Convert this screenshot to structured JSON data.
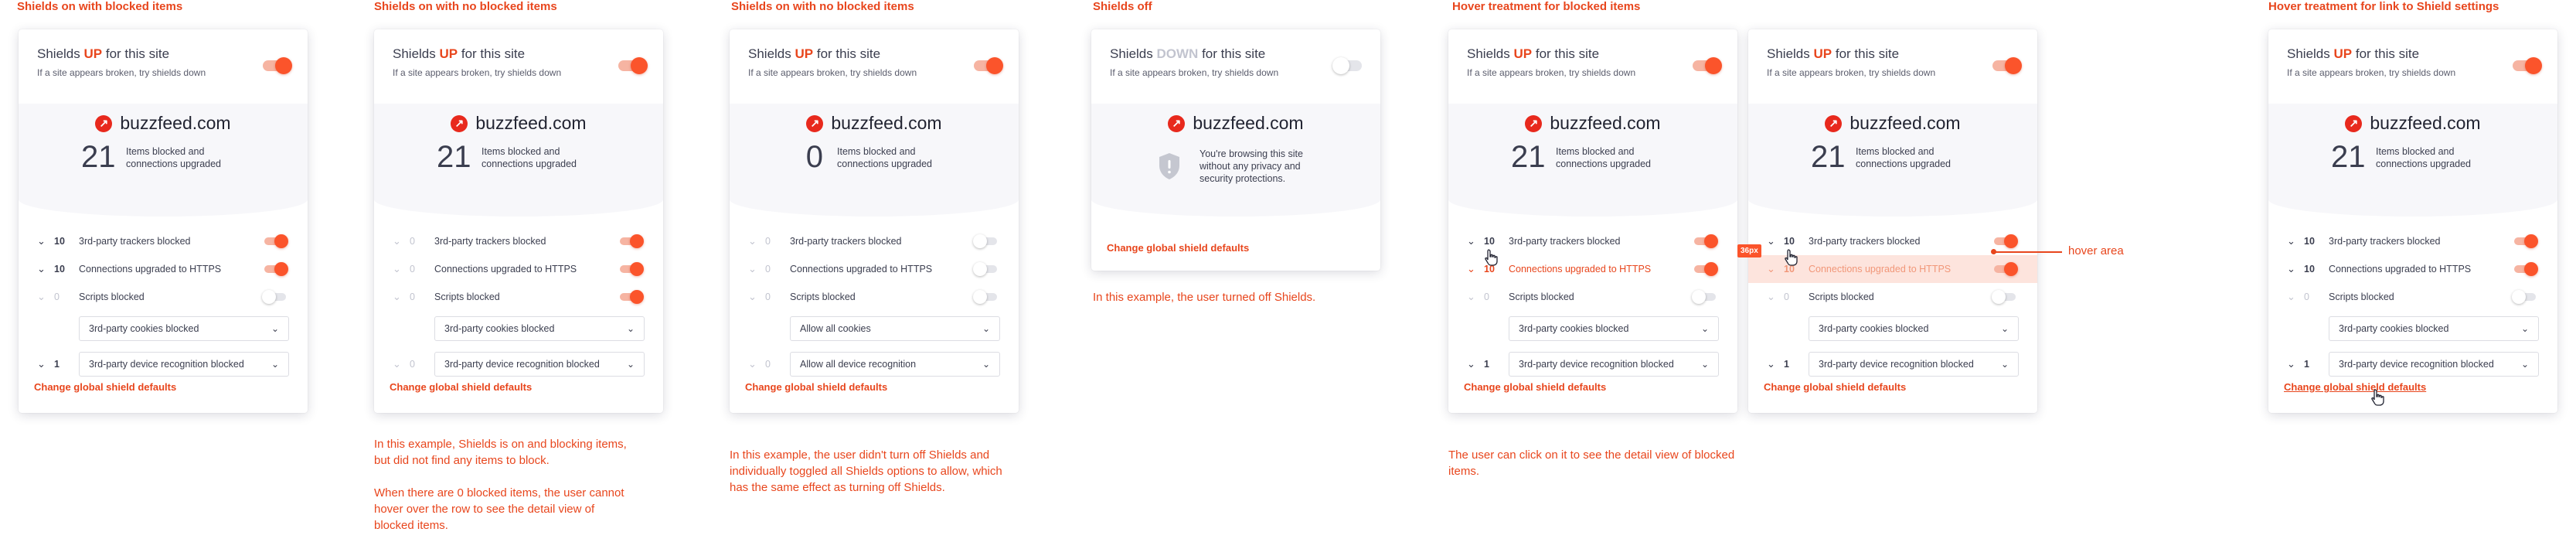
{
  "headings": [
    "Shields on with blocked items",
    "Shields on with no blocked items",
    "Shields on with no blocked items",
    "Shields off",
    "Hover treatment for blocked items",
    "Hover treatment for link to Shield settings"
  ],
  "common": {
    "title_prefix": "Shields",
    "state_up": "UP",
    "state_down": "DOWN",
    "title_suffix": "for this site",
    "subtitle": "If a site appears broken, try shields down",
    "site_name": "buzzfeed.com",
    "favicon_glyph": "↗",
    "count_label": "Items blocked and connections upgraded",
    "off_message": "You're browsing this site without any privacy and security protections.",
    "global_link": "Change global shield defaults",
    "chevron": "⌄",
    "row_trackers": "3rd-party trackers blocked",
    "row_https": "Connections upgraded to HTTPS",
    "row_scripts": "Scripts blocked",
    "sel_cookies_blocked": "3rd-party cookies blocked",
    "sel_cookies_all": "Allow all cookies",
    "sel_device_blocked": "3rd-party device recognition blocked",
    "sel_device_all": "Allow all device recognition"
  },
  "panel1": {
    "total": "21",
    "trackers": "10",
    "https": "10",
    "scripts": "0",
    "device": "1"
  },
  "panel2": {
    "total": "21",
    "trackers": "0",
    "https": "0",
    "scripts": "0",
    "device": "0"
  },
  "panel3": {
    "total": "0",
    "trackers": "0",
    "https": "0",
    "scripts": "0",
    "device": "0"
  },
  "panel5": {
    "total": "21",
    "trackers": "10",
    "https": "10",
    "scripts": "0",
    "device": "1"
  },
  "panel6": {
    "total": "21",
    "trackers": "10",
    "https": "10",
    "scripts": "0",
    "device": "1"
  },
  "panel7": {
    "total": "21",
    "trackers": "10",
    "https": "10",
    "scripts": "0",
    "device": "1"
  },
  "captions": {
    "panel2_a": "In this example, Shields is on and blocking items, but did not find any items to block.",
    "panel2_b": "When there are 0 blocked items, the user cannot hover over the row to see the detail view of blocked items.",
    "panel3": "In this example, the user didn't turn off Shields and individually toggled all Shields options to allow, which has the same effect as turning off Shields.",
    "panel4": "In this example, the user turned off Shields.",
    "panel5": "The user can click on it to see the detail view of blocked items."
  },
  "annotations": {
    "px_tag": "36px",
    "hover_area": "hover area"
  },
  "colors": {
    "accent": "#e8461d",
    "toggle_on": "#fb542b",
    "highlight": "#fde4dd",
    "panel_bg": "#f7f7fa"
  }
}
